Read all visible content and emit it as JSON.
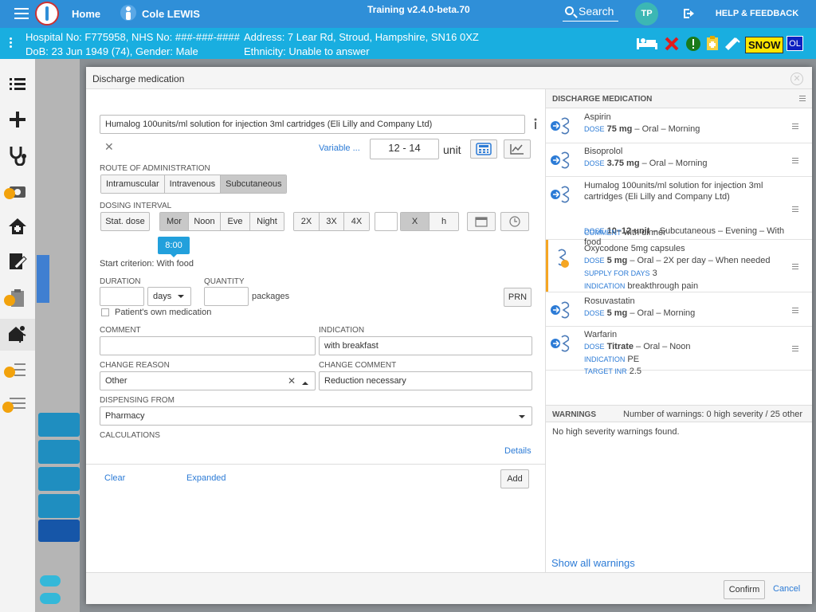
{
  "topbar": {
    "home_label": "Home",
    "patient_name": "Cole LEWIS",
    "training_version": "Training v2.4.0-beta.70",
    "search_label": "Search",
    "user_initials": "TP",
    "help_label": "HELP & FEEDBACK"
  },
  "patient": {
    "hospital_no": "Hospital No: F775958, NHS No: ###-###-####",
    "address": "Address: 7 Lear Rd, Stroud, Hampshire, SN16 0XZ",
    "dob": "DoB: 23 Jun 1949 (74), Gender: Male",
    "ethnicity": "Ethnicity: Unable to answer",
    "snow_badge": "SNOW",
    "ol_badge": "OL"
  },
  "modal": {
    "title": "Discharge medication",
    "drug_name": "Humalog 100units/ml solution for injection 3ml cartridges (Eli Lilly and Company Ltd)",
    "variable_label": "Variable ...",
    "dose_value": "12 - 14",
    "dose_unit": "unit",
    "route_label": "ROUTE OF ADMINISTRATION",
    "routes": [
      "Intramuscular",
      "Intravenous",
      "Subcutaneous"
    ],
    "dosing_label": "DOSING INTERVAL",
    "stat_dose": "Stat. dose",
    "times": [
      "Mor",
      "Noon",
      "Eve",
      "Night"
    ],
    "freqs": [
      "2X",
      "3X",
      "4X"
    ],
    "x_label": "X",
    "h_label": "h",
    "time_tip": "8:00",
    "start_criterion": "Start criterion: With food",
    "duration_label": "DURATION",
    "duration_unit": "days",
    "quantity_label": "QUANTITY",
    "quantity_unit": "packages",
    "prn_label": "PRN",
    "own_med_label": "Patient's own medication",
    "comment_label": "COMMENT",
    "indication_label": "INDICATION",
    "indication_value": "with breakfast",
    "change_reason_label": "CHANGE REASON",
    "change_reason_value": "Other",
    "change_comment_label": "CHANGE COMMENT",
    "change_comment_value": "Reduction necessary",
    "dispensing_label": "DISPENSING FROM",
    "dispensing_value": "Pharmacy",
    "calculations_label": "CALCULATIONS",
    "details_link": "Details",
    "clear_link": "Clear",
    "expanded_link": "Expanded",
    "add_button": "Add"
  },
  "discharge": {
    "title": "DISCHARGE MEDICATION",
    "meds": [
      {
        "name": "Aspirin",
        "dose_cap": "DOSE",
        "dose_val": "75 mg",
        "dose_rest": " – Oral – Morning"
      },
      {
        "name": "Bisoprolol",
        "dose_cap": "DOSE",
        "dose_val": "3.75 mg",
        "dose_rest": " – Oral – Morning"
      },
      {
        "name": "Humalog 100units/ml solution for injection 3ml cartridges (Eli Lilly and Company Ltd)",
        "dose_cap": "DOSE",
        "dose_val": "10–12 unit",
        "dose_rest": " – Subcutaneous – Evening – With food",
        "extra_cap": "COMMENT",
        "extra_val": "with dinner"
      },
      {
        "name": "Oxycodone 5mg capsules",
        "dose_cap": "DOSE",
        "dose_val": "5 mg",
        "dose_rest": " – Oral – 2X per day – When needed",
        "extra_cap": "SUPPLY FOR DAYS",
        "extra_val": "3",
        "extra2_cap": "INDICATION",
        "extra2_val": "breakthrough pain"
      },
      {
        "name": "Rosuvastatin",
        "dose_cap": "DOSE",
        "dose_val": "5 mg",
        "dose_rest": " – Oral – Morning"
      },
      {
        "name": "Warfarin",
        "dose_cap": "DOSE",
        "dose_val": "Titrate",
        "dose_rest": " – Oral – Noon",
        "extra_cap": "INDICATION",
        "extra_val": "PE",
        "extra2_cap": "TARGET INR",
        "extra2_val": "2.5"
      }
    ],
    "warnings_label": "WARNINGS",
    "warnings_count": "Number of warnings: 0 high severity / 25 other",
    "no_warnings": "No high severity warnings found.",
    "show_all": "Show all warnings"
  },
  "footer": {
    "confirm": "Confirm",
    "cancel": "Cancel"
  },
  "colors": {
    "topbar": "#2f8fd8",
    "patient_bar": "#19aee0",
    "accent": "#22a0dc",
    "warning_stripe": "#f5a623"
  }
}
